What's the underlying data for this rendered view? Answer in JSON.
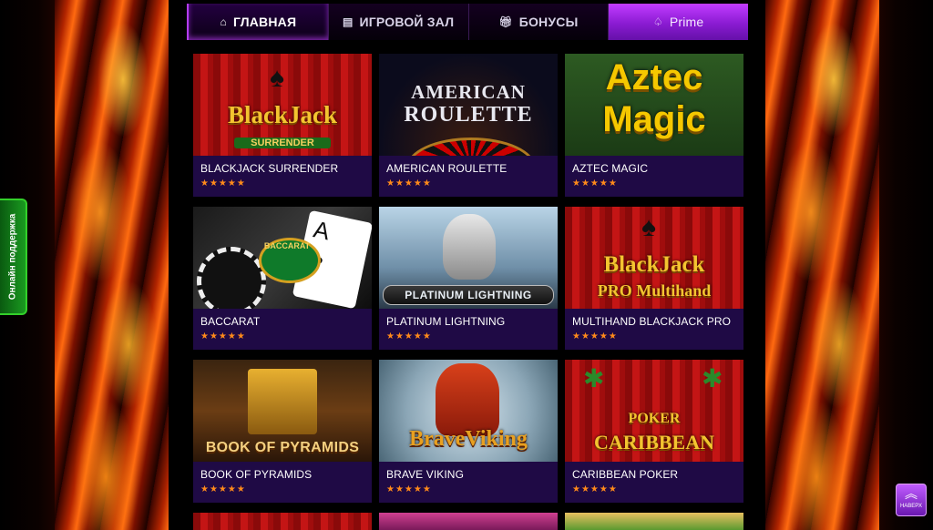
{
  "nav": {
    "home": {
      "label": "ГЛАВНАЯ",
      "icon": "home-icon"
    },
    "games": {
      "label": "ИГРОВОЙ ЗАЛ",
      "icon": "slot-icon"
    },
    "bonuses": {
      "label": "БОНУСЫ",
      "icon": "gift-icon"
    },
    "prime": {
      "label": "Prime",
      "icon": "prime-logo-icon"
    }
  },
  "games": [
    {
      "title": "BLACKJACK SURRENDER",
      "art_line1": "BlackJack",
      "art_line2": "SURRENDER",
      "stars": "★★★★★"
    },
    {
      "title": "AMERICAN ROULETTE",
      "art_line1": "AMERICAN",
      "art_line2": "ROULETTE",
      "stars": "★★★★★"
    },
    {
      "title": "AZTEC MAGIC",
      "art_line1": "Aztec",
      "art_line2": "Magic",
      "stars": "★★★★★"
    },
    {
      "title": "BACCARAT",
      "art_line1": "BACCARAT",
      "art_line2": "",
      "stars": "★★★★★"
    },
    {
      "title": "PLATINUM LIGHTNING",
      "art_line1": "PLATINUM LIGHTNING",
      "art_line2": "",
      "stars": "★★★★★"
    },
    {
      "title": "MULTIHAND BLACKJACK PRO",
      "art_line1": "BlackJack",
      "art_line2": "PRO Multihand",
      "stars": "★★★★★"
    },
    {
      "title": "BOOK OF PYRAMIDS",
      "art_line1": "BOOK OF PYRAMIDS",
      "art_line2": "",
      "stars": "★★★★★"
    },
    {
      "title": "BRAVE VIKING",
      "art_line1": "BraveViking",
      "art_line2": "",
      "stars": "★★★★★"
    },
    {
      "title": "CARIBBEAN POKER",
      "art_line1": "POKER",
      "art_line2": "CARIBBEAN",
      "stars": "★★★★★"
    }
  ],
  "support": {
    "label": "Онлайн поддержка"
  },
  "scroll_top": {
    "label": "НАВЕРХ",
    "icon": "chevron-up-icon"
  },
  "colors": {
    "accent": "#b43cff",
    "card_bg": "#1f0a45",
    "star": "#ff8a1a"
  }
}
